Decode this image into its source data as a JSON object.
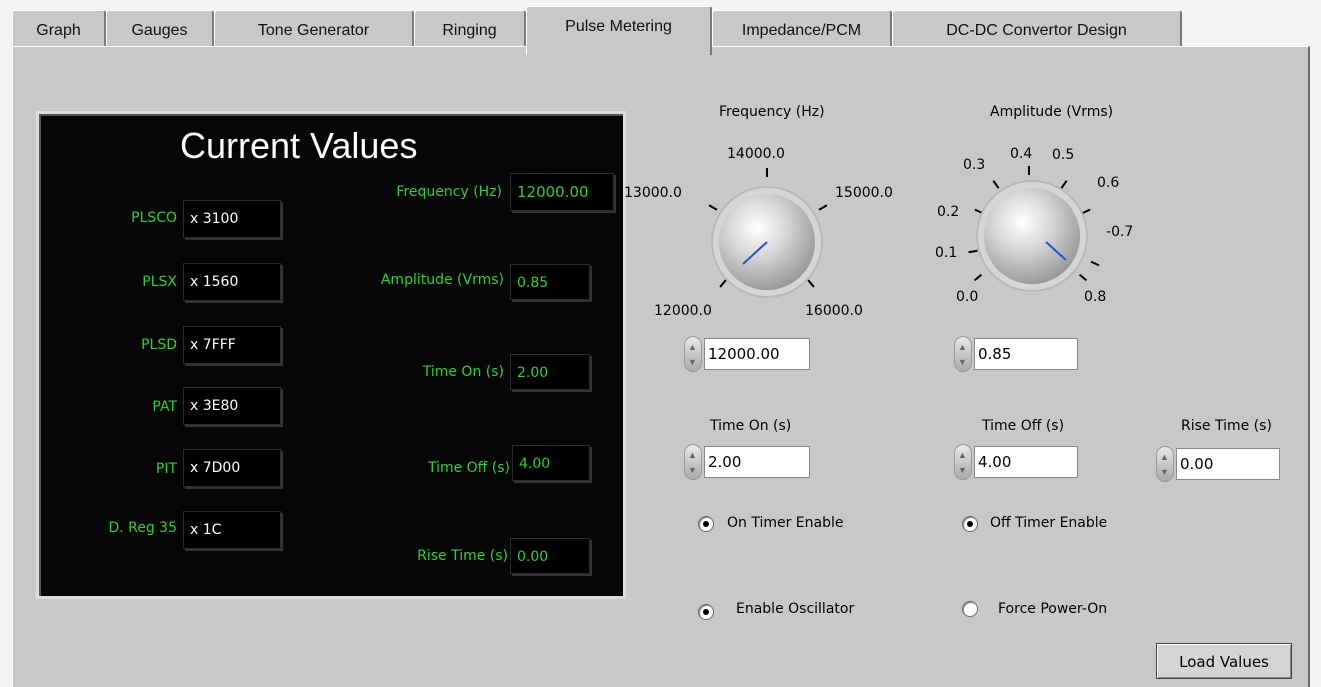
{
  "tabs": [
    "Graph",
    "Gauges",
    "Tone Generator",
    "Ringing",
    "Pulse Metering",
    "Impedance/PCM",
    "DC-DC Convertor Design"
  ],
  "active_tab": "Pulse Metering",
  "current_values": {
    "title": "Current Values",
    "registers": [
      {
        "label": "PLSCO",
        "value": "x 3100"
      },
      {
        "label": "PLSX",
        "value": "x 1560"
      },
      {
        "label": "PLSD",
        "value": "x 7FFF"
      },
      {
        "label": "PAT",
        "value": "x 3E80"
      },
      {
        "label": "PIT",
        "value": "x 7D00"
      },
      {
        "label": "D. Reg 35",
        "value": "x 1C"
      }
    ],
    "readouts": [
      {
        "label": "Frequency (Hz)",
        "value": "12000.00"
      },
      {
        "label": "Amplitude (Vrms)",
        "value": "0.85"
      },
      {
        "label": "Time On (s)",
        "value": "2.00"
      },
      {
        "label": "Time Off (s)",
        "value": "4.00"
      },
      {
        "label": "Rise Time (s)",
        "value": "0.00"
      }
    ]
  },
  "frequency_knob": {
    "title": "Frequency (Hz)",
    "scale": [
      "12000.0",
      "13000.0",
      "14000.0",
      "15000.0",
      "16000.0"
    ],
    "value": "12000.00"
  },
  "amplitude_knob": {
    "title": "Amplitude (Vrms)",
    "scale": [
      "0.0",
      "0.1",
      "0.2",
      "0.3",
      "0.4",
      "0.5",
      "0.6",
      "0.7",
      "0.8"
    ],
    "value": "0.85"
  },
  "time_on": {
    "label": "Time On (s)",
    "value": "2.00"
  },
  "time_off": {
    "label": "Time Off (s)",
    "value": "4.00"
  },
  "rise_time": {
    "label": "Rise Time (s)",
    "value": "0.00"
  },
  "options": {
    "on_timer_enable": {
      "label": "On Timer Enable",
      "checked": true
    },
    "off_timer_enable": {
      "label": "Off Timer Enable",
      "checked": true
    },
    "enable_oscillator": {
      "label": "Enable Oscillator",
      "checked": true
    },
    "force_power_on": {
      "label": "Force Power-On",
      "checked": false
    }
  },
  "load_button": "Load Values"
}
